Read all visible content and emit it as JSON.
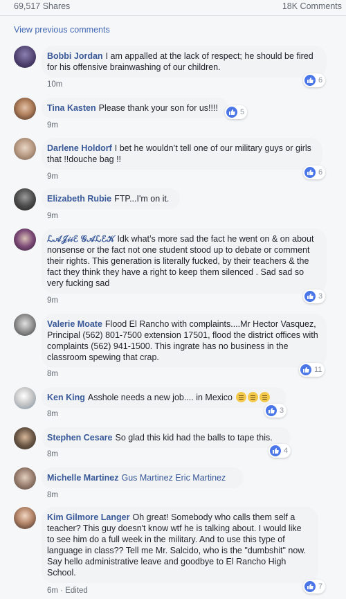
{
  "header": {
    "shares": "69,517 Shares",
    "comments": "18K Comments"
  },
  "view_previous": "View previous comments",
  "comments": [
    {
      "name": "Bobbi Jordan",
      "text": "I am appalled at the lack of respect; he should be fired for his offensive brainwashing of our children.",
      "time": "10m",
      "likes": "6"
    },
    {
      "name": "Tina Kasten",
      "text": "Please thank your son for us!!!!",
      "time": "9m",
      "likes": "5"
    },
    {
      "name": "Darlene Holdorf",
      "text": "I bet he wouldn’t tell one of our military guys or girls that !!douche bag !!",
      "time": "9m",
      "likes": "6"
    },
    {
      "name": "Elizabeth Rubie",
      "text": "FTP...I'm on it.",
      "time": "9m",
      "likes": ""
    },
    {
      "name": "ℒ𝒜𝒥𝒾𝒾ℰ 𝒢𝒜ℒℰ𝒦",
      "text": "Idk what’s more sad the fact he went on & on about nonsense or the fact not one student stood up to debate or comment their rights. This generation is literally fucked, by their teachers & the fact they think they have a right to keep them silenced . Sad sad so very fucking sad",
      "time": "9m",
      "likes": "3"
    },
    {
      "name": "Valerie Moate",
      "text": "Flood El Rancho with complaints....Mr Hector Vasquez, Principal (562) 801-7500 extension 17501, flood the district offices with complaints (562) 941-1500. This ingrate has no business in the classroom spewing that crap.",
      "time": "8m",
      "likes": "11"
    },
    {
      "name": "Ken King",
      "text": "Asshole needs a new job.... in Mexico",
      "time": "8m",
      "likes": "3"
    },
    {
      "name": "Stephen Cesare",
      "text": "So glad this kid had the balls to tape this.",
      "time": "8m",
      "likes": "4"
    },
    {
      "name": "Michelle Martinez",
      "text": "Gus Martinez Eric Martinez",
      "time": "8m",
      "likes": ""
    },
    {
      "name": "Kim Gilmore Langer",
      "text": "Oh great! Somebody who calls them self a teacher? This guy doesn't know wtf he is talking about. I would like to see him do a full week in the military. And to use this type of language in class?? Tell me Mr. Salcido, who is the \"dumbshit\" now. Say hello administrative leave and goodbye to El Rancho High School.",
      "time": "6m · Edited",
      "likes": "7"
    }
  ],
  "colors": {
    "name": "#385898",
    "link": "#4267b2",
    "bubble": "#f2f3f5",
    "like_badge": "#4a76e8"
  }
}
